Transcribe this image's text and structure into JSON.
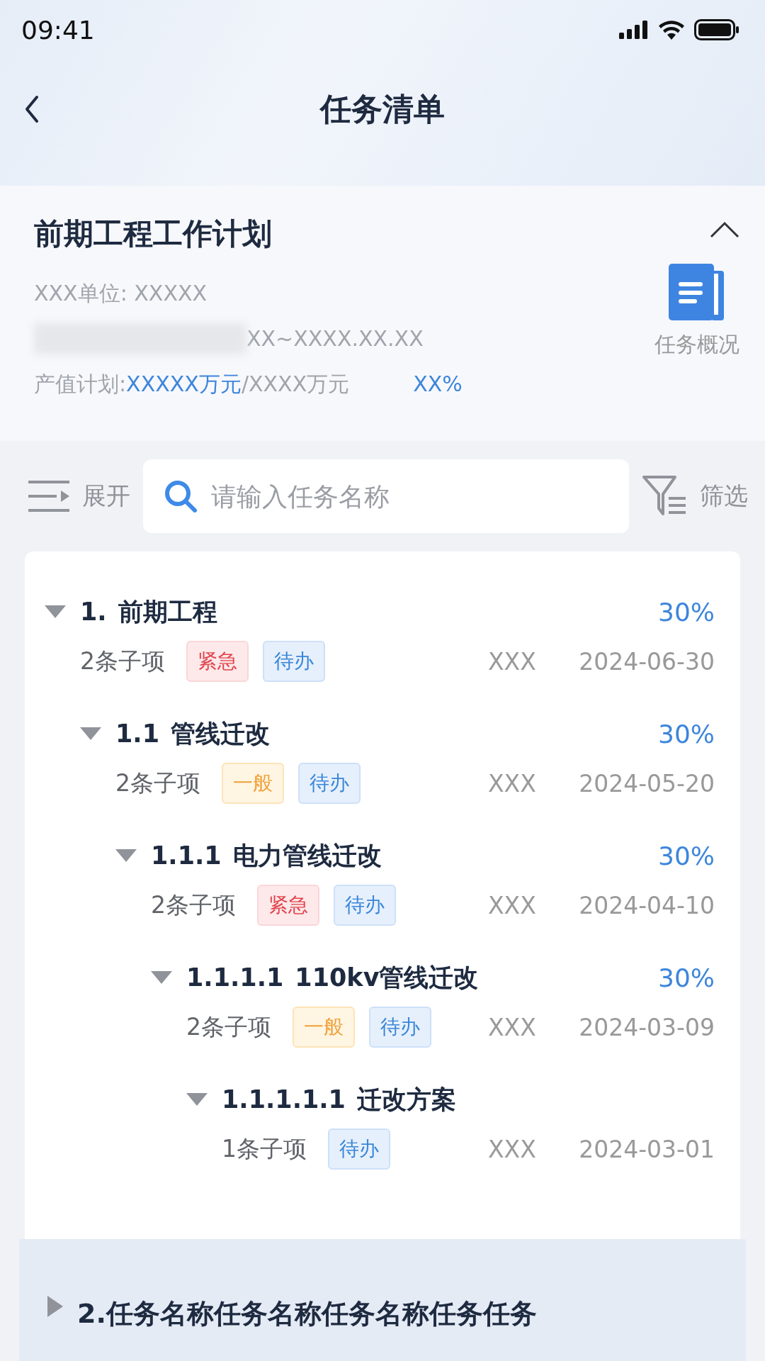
{
  "status_bar": {
    "time": "09:41"
  },
  "nav": {
    "title": "任务清单"
  },
  "plan": {
    "title": "前期工程工作计划",
    "expanded": true,
    "unit": "XXX单位: XXXXX",
    "period": "XX~XXXX.XX.XX",
    "value_label": "产值计划:",
    "value_done": "XXXXX万元",
    "value_total": "/XXXX万元",
    "percent": "XX%",
    "overview": "任务概况"
  },
  "toolbar": {
    "expand": "展开",
    "search": {
      "placeholder": "请输入任务名称"
    },
    "filter": "筛选"
  },
  "tasks": [
    {
      "code": "1.",
      "name": "前期工程",
      "percent": "30%",
      "count": "2条子项",
      "tags": [
        {
          "label": "紧急",
          "kind": "urgent"
        },
        {
          "label": "待办",
          "kind": "todo"
        }
      ],
      "owner": "XXX",
      "date": "2024-06-30",
      "expanded": true,
      "children": [
        {
          "code": "1.1",
          "name": "管线迁改",
          "percent": "30%",
          "count": "2条子项",
          "tags": [
            {
              "label": "一般",
              "kind": "normal"
            },
            {
              "label": "待办",
              "kind": "todo"
            }
          ],
          "owner": "XXX",
          "date": "2024-05-20",
          "expanded": true,
          "children": [
            {
              "code": "1.1.1",
              "name": "电力管线迁改",
              "percent": "30%",
              "count": "2条子项",
              "tags": [
                {
                  "label": "紧急",
                  "kind": "urgent"
                },
                {
                  "label": "待办",
                  "kind": "todo"
                }
              ],
              "owner": "XXX",
              "date": "2024-04-10",
              "expanded": true,
              "children": [
                {
                  "code": "1.1.1.1",
                  "name": "110kv管线迁改",
                  "percent": "30%",
                  "count": "2条子项",
                  "tags": [
                    {
                      "label": "一般",
                      "kind": "normal"
                    },
                    {
                      "label": "待办",
                      "kind": "todo"
                    }
                  ],
                  "owner": "XXX",
                  "date": "2024-03-09",
                  "expanded": true,
                  "children": [
                    {
                      "code": "1.1.1.1.1",
                      "name": "迁改方案",
                      "count": "1条子项",
                      "tags": [
                        {
                          "label": "待办",
                          "kind": "todo"
                        }
                      ],
                      "owner": "XXX",
                      "date": "2024-03-01",
                      "expanded": true
                    }
                  ]
                }
              ]
            }
          ]
        }
      ]
    },
    {
      "code": "2.",
      "name": "任务名称任务名称任务名称任务任务",
      "expanded": false
    }
  ]
}
